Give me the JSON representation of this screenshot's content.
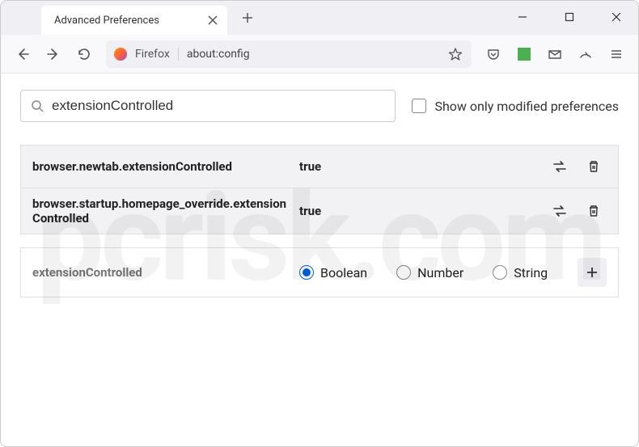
{
  "window": {
    "tab_title": "Advanced Preferences"
  },
  "toolbar": {
    "identity": "Firefox",
    "url": "about:config"
  },
  "search": {
    "value": "extensionControlled",
    "checkbox_label": "Show only modified preferences"
  },
  "prefs": [
    {
      "name": "browser.newtab.extensionControlled",
      "value": "true"
    },
    {
      "name": "browser.startup.homepage_override.extensionControlled",
      "value": "true"
    }
  ],
  "new_pref": {
    "name": "extensionControlled",
    "types": [
      "Boolean",
      "Number",
      "String"
    ],
    "selected": "Boolean"
  },
  "watermark": "pcrisk.com"
}
